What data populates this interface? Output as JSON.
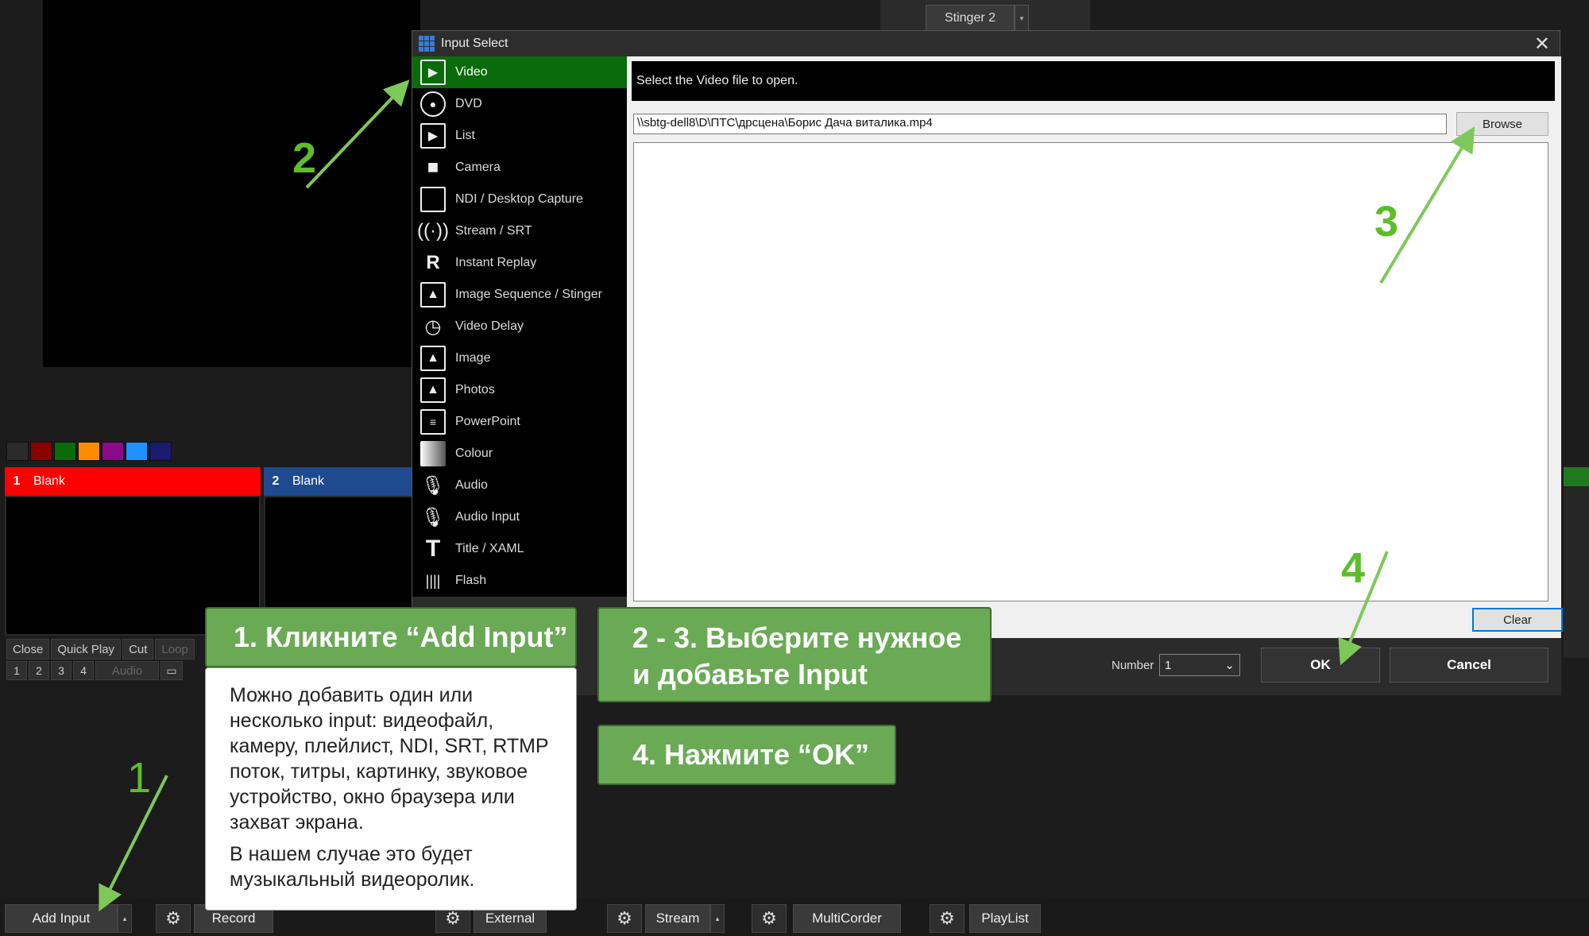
{
  "background": {
    "stinger_label": "Stinger 2",
    "inputs": [
      {
        "number": "1",
        "title": "Blank",
        "color": "#ff0000"
      },
      {
        "number": "2",
        "title": "Blank",
        "color": "#1f4a8f"
      }
    ],
    "color_swatches": [
      "#2b2b2b",
      "#8b0000",
      "#0a6b0a",
      "#ff8c00",
      "#8a0a8a",
      "#1e90ff",
      "#1a1a6e"
    ],
    "control_row": [
      "Close",
      "Quick Play",
      "Cut",
      "Loop"
    ],
    "number_row": [
      "1",
      "2",
      "3",
      "4"
    ],
    "audio_label": "Audio",
    "bottom_bar": {
      "add_input": "Add Input",
      "record": "Record",
      "external": "External",
      "stream": "Stream",
      "multicorder": "MultiCorder",
      "playlist": "PlayList"
    }
  },
  "dialog": {
    "title": "Input Select",
    "sidebar": [
      {
        "label": "Video",
        "icon": "video-icon",
        "active": true
      },
      {
        "label": "DVD",
        "icon": "dvd-icon"
      },
      {
        "label": "List",
        "icon": "list-icon"
      },
      {
        "label": "Camera",
        "icon": "camera-icon"
      },
      {
        "label": "NDI / Desktop Capture",
        "icon": "monitor-icon"
      },
      {
        "label": "Stream / SRT",
        "icon": "antenna-icon"
      },
      {
        "label": "Instant Replay",
        "icon": "replay-icon"
      },
      {
        "label": "Image Sequence / Stinger",
        "icon": "image-sequence-icon"
      },
      {
        "label": "Video Delay",
        "icon": "clock-icon"
      },
      {
        "label": "Image",
        "icon": "image-icon"
      },
      {
        "label": "Photos",
        "icon": "photos-icon"
      },
      {
        "label": "PowerPoint",
        "icon": "presentation-icon"
      },
      {
        "label": "Colour",
        "icon": "colour-icon"
      },
      {
        "label": "Audio",
        "icon": "microphone-icon"
      },
      {
        "label": "Audio Input",
        "icon": "audio-input-icon"
      },
      {
        "label": "Title / XAML",
        "icon": "title-icon"
      },
      {
        "label": "Flash",
        "icon": "flash-icon"
      }
    ],
    "hint": "Select the Video file to open.",
    "file_path": "\\\\sbtg-dell8\\D\\ПТС\\дрсцена\\Борис Дача виталика.mp4",
    "browse_label": "Browse",
    "clear_label": "Clear",
    "number_label": "Number",
    "number_value": "1",
    "ok_label": "OK",
    "cancel_label": "Cancel"
  },
  "annotations": {
    "step1_title": "1. Кликните “Add Input”",
    "step1_body": "Можно добавить один или несколько input: видеофайл, камеру, плейлист, NDI, SRT, RTMP поток, титры, картинку, звуковое устройство, окно браузера или захват экрана.",
    "step1_note": "В нашем случае это будет музыкальный видеоролик.",
    "step23_title": "2 - 3. Выберите нужное и добавьте Input",
    "step4_title": "4. Нажмите “OK”",
    "marker_1": "1",
    "marker_2": "2",
    "marker_3": "3",
    "marker_4": "4"
  }
}
